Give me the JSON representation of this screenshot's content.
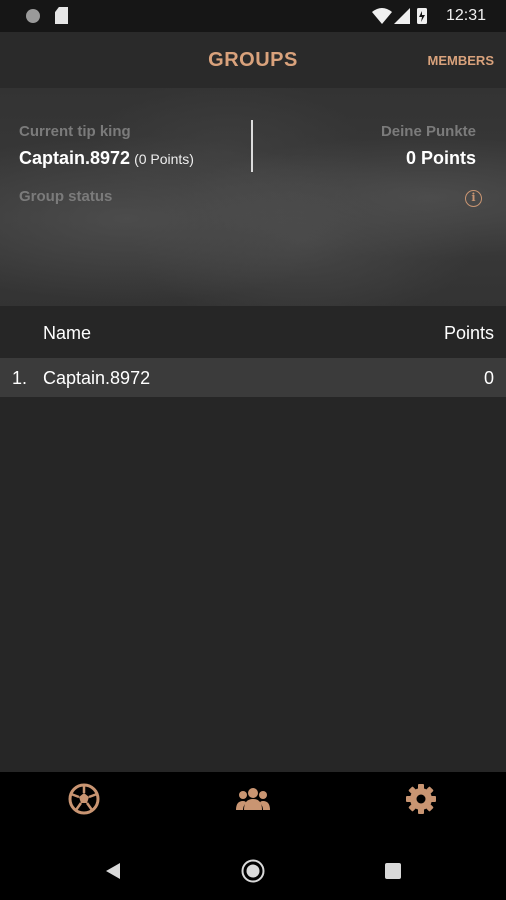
{
  "status_bar": {
    "time": "12:31"
  },
  "app_bar": {
    "title": "GROUPS",
    "members_label": "MEMBERS"
  },
  "header": {
    "tip_king_label": "Current tip king",
    "tip_king_name": "Captain.8972",
    "tip_king_points": "(0 Points)",
    "your_points_label": "Deine Punkte",
    "your_points_value": "0 Points",
    "group_status_label": "Group status",
    "info_icon": "info-icon"
  },
  "table": {
    "columns": [
      "Name",
      "Points"
    ],
    "rows": [
      {
        "rank": "1.",
        "name": "Captain.8972",
        "points": "0"
      }
    ]
  },
  "bottom_nav": {
    "items": [
      {
        "icon": "soccer-ball-icon"
      },
      {
        "icon": "group-icon"
      },
      {
        "icon": "gear-icon"
      }
    ]
  },
  "colors": {
    "accent": "#d9a27c",
    "background": "#262626",
    "row_highlight": "#3b3b3b"
  }
}
